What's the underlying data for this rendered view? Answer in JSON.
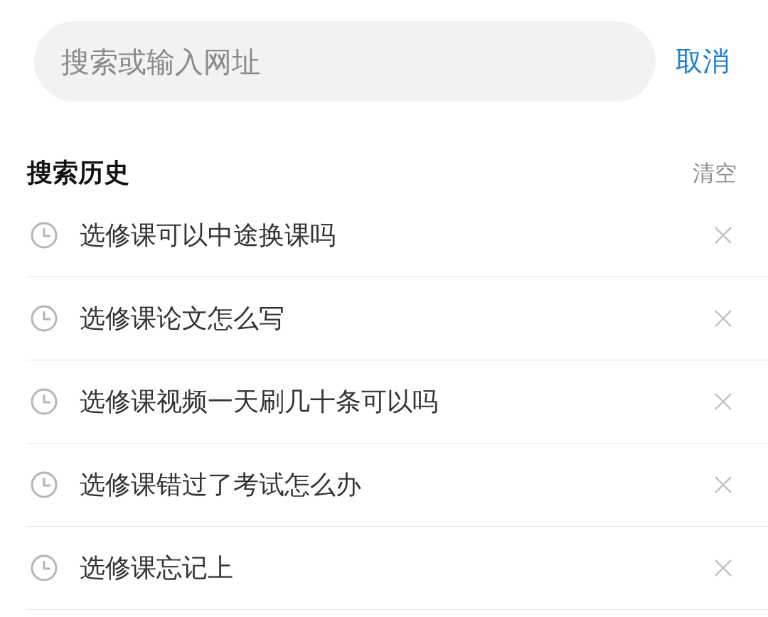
{
  "search": {
    "placeholder": "搜索或输入网址"
  },
  "cancel": "取消",
  "history": {
    "title": "搜索历史",
    "clear": "清空",
    "items": [
      {
        "text": "选修课可以中途换课吗"
      },
      {
        "text": "选修课论文怎么写"
      },
      {
        "text": "选修课视频一天刷几十条可以吗"
      },
      {
        "text": "选修课错过了考试怎么办"
      },
      {
        "text": "选修课忘记上"
      }
    ]
  }
}
